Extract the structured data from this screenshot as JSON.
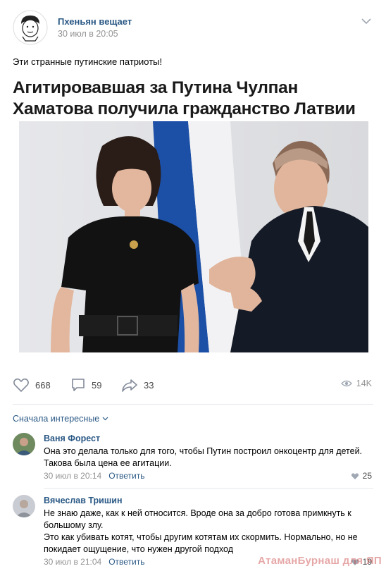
{
  "post": {
    "author": "Пхеньян вещает",
    "time": "30 июл в 20:05",
    "text": "Эти странные путинские патриоты!",
    "headline_line1": "Агитировавшая за Путина Чулпан",
    "headline_line2": "Хаматова получила гражданство Латвии"
  },
  "actions": {
    "likes": "668",
    "comments": "59",
    "shares": "33",
    "views": "14K"
  },
  "comments_section": {
    "sort_label": "Сначала интересные"
  },
  "comments": [
    {
      "name": "Ваня Форест",
      "text": "Она это делала только для того, чтобы Путин построил онкоцентр для детей. Такова была цена ее агитации.",
      "time": "30 июл в 20:14",
      "reply": "Ответить",
      "likes": "25"
    },
    {
      "name": "Вячеслав Тришин",
      "text1": "Не знаю даже, как к ней относится. Вроде она за добро готова примкнуть к большому злу.",
      "text2": "Это как убивать котят, чтобы другим котятам их скормить. Нормально, но не покидает ощущение, что нужен другой подход",
      "time": "30 июл в 21:04",
      "reply": "Ответить",
      "likes": "19"
    }
  ],
  "watermark": "АтаманБурнаш для ЯП",
  "colors": {
    "link": "#2a5885",
    "meta": "#939393",
    "flag_blue": "#1c4fa6"
  }
}
